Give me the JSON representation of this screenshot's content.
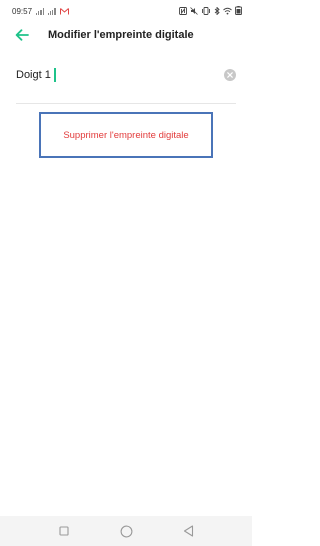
{
  "status_bar": {
    "time": "09:57",
    "battery_percent": "",
    "icons": [
      "signal-icon",
      "mail-icon",
      "nfc-icon",
      "mute-icon",
      "vibrate-icon",
      "bluetooth-icon",
      "wifi-icon",
      "battery-icon"
    ]
  },
  "header": {
    "back_icon": "back-arrow-icon",
    "title": "Modifier l'empreinte digitale"
  },
  "name_field": {
    "value": "Doigt 1",
    "clear_icon": "clear-icon"
  },
  "actions": {
    "delete_label": "Supprimer l'empreinte digitale"
  },
  "nav_bar": {
    "buttons": [
      "recent-apps-icon",
      "home-icon",
      "back-icon"
    ]
  },
  "colors": {
    "accent": "#1ec38a",
    "danger": "#e23b3b",
    "highlight_border": "#4a74b8"
  }
}
